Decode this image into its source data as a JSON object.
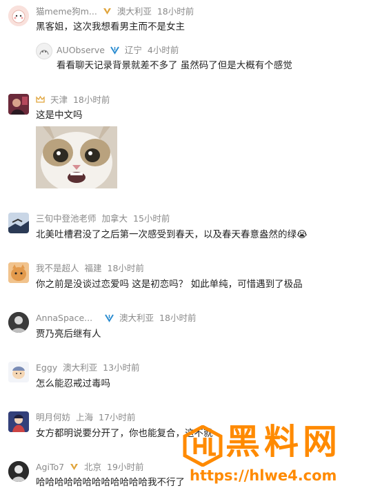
{
  "comments": [
    {
      "user": "猫meme狗m...",
      "location": "澳大利亚",
      "time": "18小时前",
      "text": "黑客姐，这次我想看男主而不是女主",
      "reply": {
        "user": "AUObserve",
        "location": "辽宁",
        "time": "4小时前",
        "text": "看看聊天记录背景就差不多了 虽然码了但是大概有个感觉"
      }
    },
    {
      "user": "天津",
      "time": "18小时前",
      "text": "这是中文吗"
    },
    {
      "user": "三旬中登池老师",
      "location": "加拿大",
      "time": "15小时前",
      "text": "北美吐槽君没了之后第一次感受到春天，以及春天春意盎然的绿"
    },
    {
      "user": "我不是超人",
      "location": "福建",
      "time": "18小时前",
      "text": "你之前是没谈过恋爱吗 这是初恋吗？ 如此单纯，可惜遇到了极品"
    },
    {
      "user": "AnnaSpace...",
      "location": "澳大利亚",
      "time": "18小时前",
      "text": "贾乃亮后继有人"
    },
    {
      "user": "Eggy",
      "location": "澳大利亚",
      "time": "13小时前",
      "text": "怎么能忍戒过毒吗"
    },
    {
      "user": "明月何妨",
      "location": "上海",
      "time": "17小时前",
      "text": "女方都明说要分开了，你也能复合，这不就"
    },
    {
      "user": "AgiTo7",
      "location": "北京",
      "time": "19小时前",
      "text": "哈哈哈哈哈哈哈哈哈哈哈哈我不行了"
    }
  ],
  "emoji": "😭",
  "watermark": {
    "title": "黑料网",
    "url": "https://hlwe4.com"
  },
  "colors": {
    "meta": "#8a8a8a",
    "text": "#222222",
    "watermark": "#ff8a00",
    "verified": "#2a8cd0",
    "gold": "#e0a43b"
  }
}
